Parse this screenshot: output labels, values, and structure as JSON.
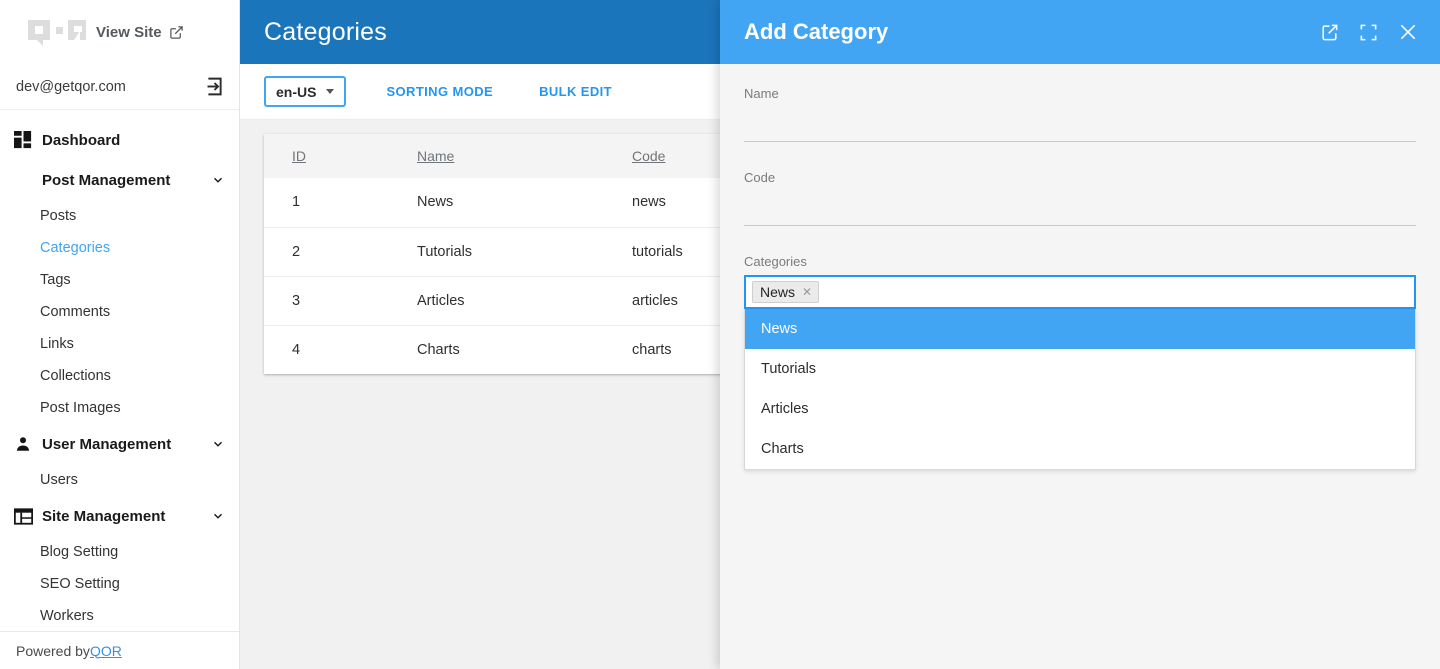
{
  "sidebar": {
    "logo_icon": "qor-logo",
    "view_site_label": "View Site",
    "view_site_icon": "external-link-icon",
    "user_email": "dev@getqor.com",
    "logout_icon": "logout-icon",
    "nav": [
      {
        "type": "group",
        "label": "Dashboard",
        "icon": "dashboard-grid-icon",
        "expandable": false
      },
      {
        "type": "group",
        "label": "Post Management",
        "icon": "none",
        "expandable": true,
        "chevron": "chevron-down-icon"
      },
      {
        "type": "item",
        "label": "Posts",
        "active": false
      },
      {
        "type": "item",
        "label": "Categories",
        "active": true
      },
      {
        "type": "item",
        "label": "Tags",
        "active": false
      },
      {
        "type": "item",
        "label": "Comments",
        "active": false
      },
      {
        "type": "item",
        "label": "Links",
        "active": false
      },
      {
        "type": "item",
        "label": "Collections",
        "active": false
      },
      {
        "type": "item",
        "label": "Post Images",
        "active": false
      },
      {
        "type": "group",
        "label": "User Management",
        "icon": "person-icon",
        "expandable": true,
        "chevron": "chevron-down-icon"
      },
      {
        "type": "item",
        "label": "Users",
        "active": false
      },
      {
        "type": "group",
        "label": "Site Management",
        "icon": "web-layout-icon",
        "expandable": true,
        "chevron": "chevron-down-icon"
      },
      {
        "type": "item",
        "label": "Blog Setting",
        "active": false
      },
      {
        "type": "item",
        "label": "SEO Setting",
        "active": false
      },
      {
        "type": "item",
        "label": "Workers",
        "active": false
      }
    ],
    "footer_prefix": "Powered by ",
    "footer_link": "QOR"
  },
  "main": {
    "title": "Categories",
    "header_color": "#1b75bb",
    "toolbar": {
      "locale_value": "en-US",
      "locale_caret_icon": "caret-down-icon",
      "sorting_mode_label": "SORTING MODE",
      "bulk_edit_label": "BULK EDIT",
      "link_color": "#2196f3"
    },
    "table": {
      "columns": [
        "ID",
        "Name",
        "Code"
      ],
      "rows": [
        {
          "id": "1",
          "name": "News",
          "code": "news"
        },
        {
          "id": "2",
          "name": "Tutorials",
          "code": "tutorials"
        },
        {
          "id": "3",
          "name": "Articles",
          "code": "articles"
        },
        {
          "id": "4",
          "name": "Charts",
          "code": "charts"
        }
      ]
    }
  },
  "panel": {
    "title": "Add Category",
    "header_color": "#41a5f4",
    "actions": [
      {
        "name": "open-in-new-icon",
        "label": "Open in new window"
      },
      {
        "name": "fullscreen-icon",
        "label": "Fullscreen"
      },
      {
        "name": "close-icon",
        "label": "Close"
      }
    ],
    "fields": {
      "name": {
        "label": "Name",
        "value": "",
        "placeholder": ""
      },
      "code": {
        "label": "Code",
        "value": "",
        "placeholder": ""
      },
      "categories": {
        "label": "Categories",
        "chips": [
          {
            "label": "News",
            "remove_icon": "chip-remove-icon"
          }
        ],
        "options": [
          {
            "label": "News",
            "selected": true
          },
          {
            "label": "Tutorials",
            "selected": false
          },
          {
            "label": "Articles",
            "selected": false
          },
          {
            "label": "Charts",
            "selected": false
          }
        ]
      }
    }
  }
}
